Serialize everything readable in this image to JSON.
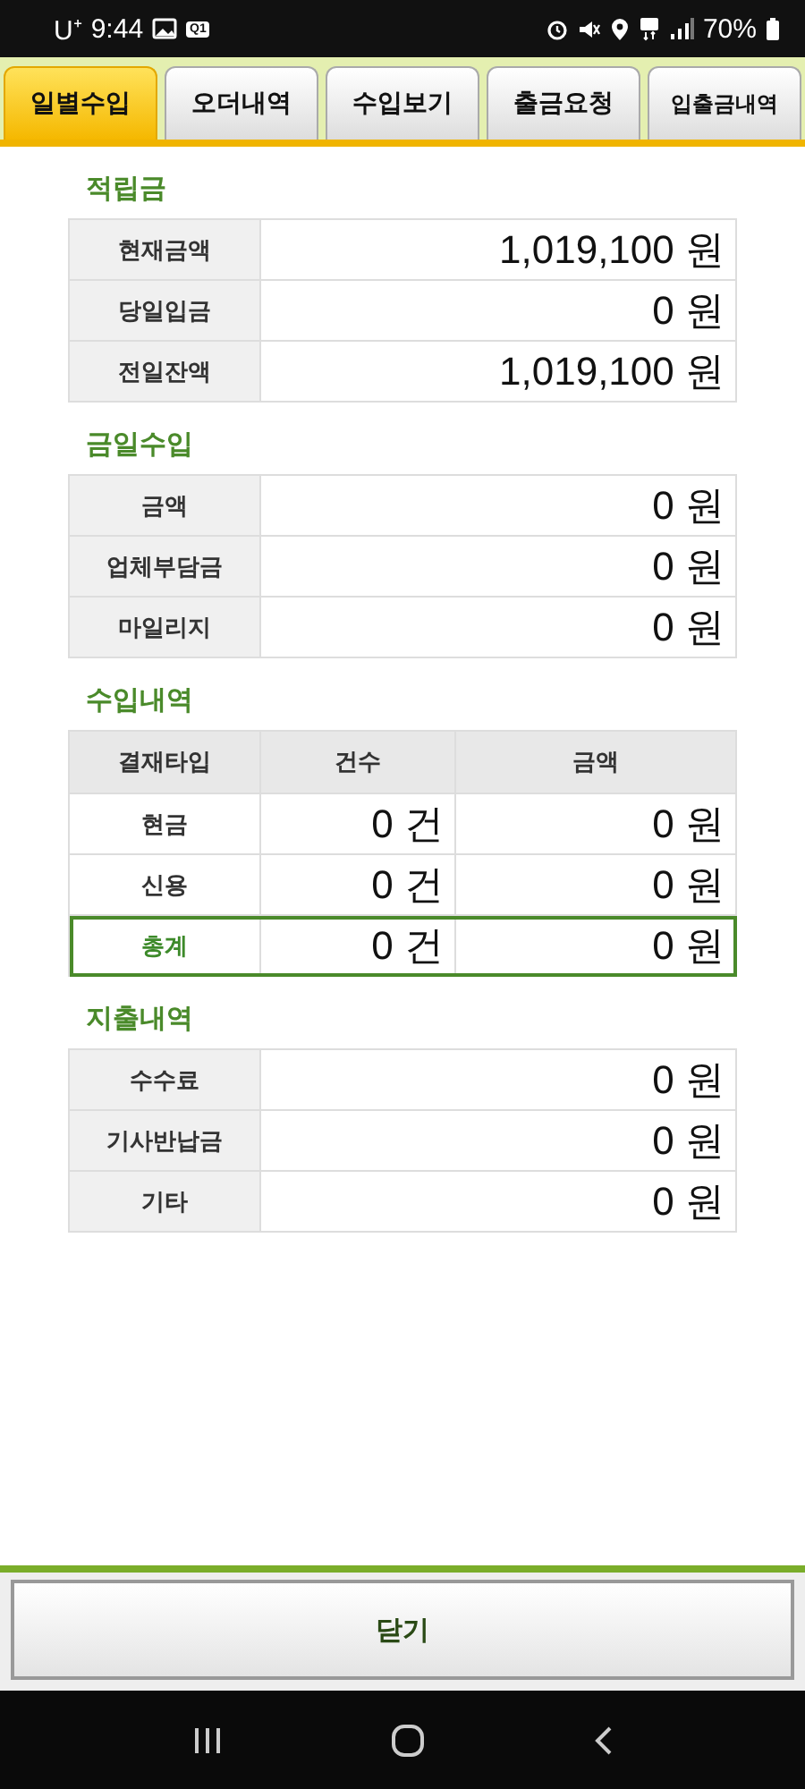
{
  "status_bar": {
    "carrier": "U⁺",
    "time": "9:44",
    "notification_badge": "Q1",
    "battery": "70%"
  },
  "tabs": [
    {
      "label": "일별수입",
      "selected": true
    },
    {
      "label": "오더내역",
      "selected": false
    },
    {
      "label": "수입보기",
      "selected": false
    },
    {
      "label": "출금요청",
      "selected": false
    },
    {
      "label": "입출금내역",
      "selected": false
    }
  ],
  "sections": [
    {
      "kind": "pairs",
      "title": "적립금",
      "rows": [
        {
          "label": "현재금액",
          "value": "1,019,100 원"
        },
        {
          "label": "당일입금",
          "value": "0 원"
        },
        {
          "label": "전일잔액",
          "value": "1,019,100 원"
        }
      ]
    },
    {
      "kind": "pairs",
      "title": "금일수입",
      "rows": [
        {
          "label": "금액",
          "value": "0 원"
        },
        {
          "label": "업체부담금",
          "value": "0 원"
        },
        {
          "label": "마일리지",
          "value": "0 원"
        }
      ]
    },
    {
      "kind": "grid",
      "title": "수입내역",
      "columns": [
        "결재타입",
        "건수",
        "금액"
      ],
      "rows": [
        {
          "label": "현금",
          "count": "0 건",
          "amount": "0 원",
          "highlighted": false
        },
        {
          "label": "신용",
          "count": "0 건",
          "amount": "0 원",
          "highlighted": false
        },
        {
          "label": "총계",
          "count": "0 건",
          "amount": "0 원",
          "highlighted": true
        }
      ]
    },
    {
      "kind": "pairs",
      "title": "지출내역",
      "rows": [
        {
          "label": "수수료",
          "value": "0 원"
        },
        {
          "label": "기사반납금",
          "value": "0 원"
        },
        {
          "label": "기타",
          "value": "0 원"
        }
      ]
    }
  ],
  "close_button": "닫기"
}
